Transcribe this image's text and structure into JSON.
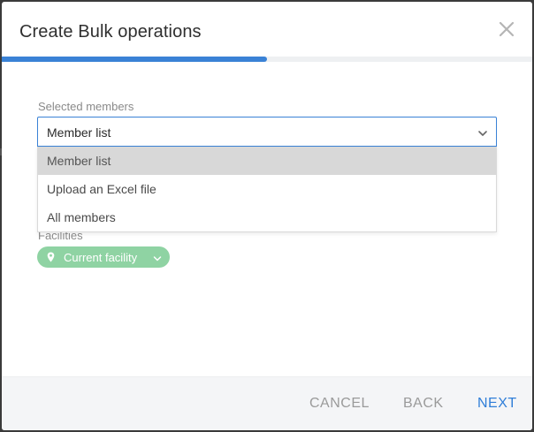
{
  "dialog": {
    "title": "Create Bulk operations",
    "close_icon": "close-icon",
    "progress_percent": 50,
    "colors": {
      "accent": "#3a82d6",
      "chip": "#8fd3a3",
      "next": "#2f7ed8"
    }
  },
  "form": {
    "members_label": "Selected members",
    "members_value": "Member list",
    "dropdown_options": [
      {
        "label": "Member list",
        "selected": true
      },
      {
        "label": "Upload an Excel file",
        "selected": false
      },
      {
        "label": "All members",
        "selected": false
      }
    ],
    "facilities_label": "Facilities",
    "facility_chip": {
      "label": "Current facility",
      "icon": "location-pin-icon"
    }
  },
  "footer": {
    "cancel_label": "CANCEL",
    "back_label": "BACK",
    "next_label": "NEXT"
  }
}
